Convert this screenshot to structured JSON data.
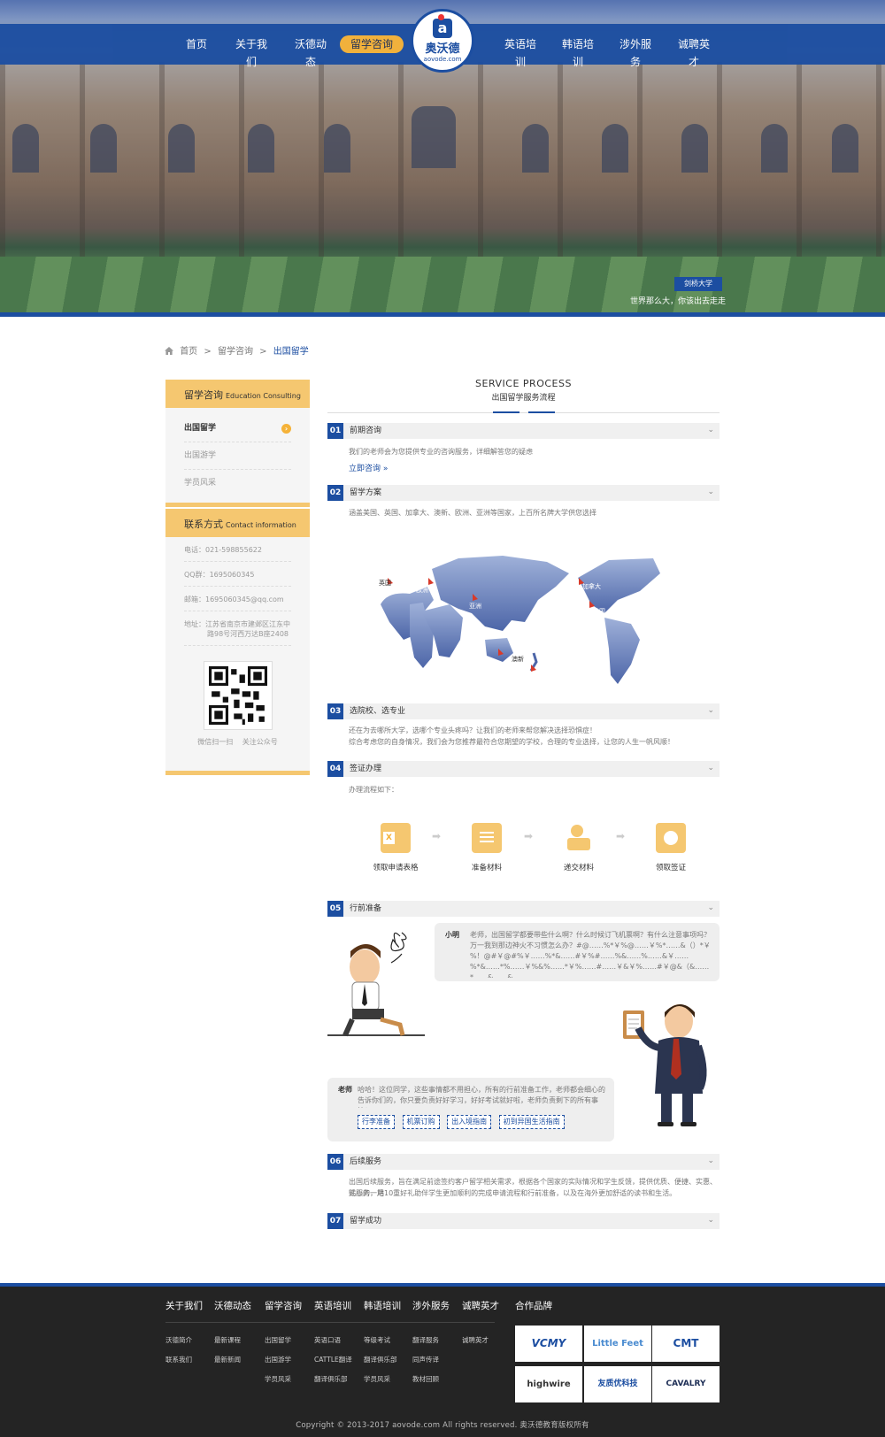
{
  "nav": {
    "left": [
      "首页",
      "关于我们",
      "沃德动态",
      "留学咨询"
    ],
    "right": [
      "英语培训",
      "韩语培训",
      "涉外服务",
      "诚聘英才"
    ],
    "active": "留学咨询"
  },
  "logo": {
    "name": "奥沃德",
    "domain": "aovode.com",
    "mark": "a"
  },
  "hero": {
    "badge": "剑桥大学",
    "slogan": "世界那么大，你该出去走走"
  },
  "breadcrumb": {
    "home": "首页",
    "sep": ">",
    "level1": "留学咨询",
    "current": "出国留学"
  },
  "sidebar": {
    "consult": {
      "title": "留学咨询",
      "subtitle": "Education Consulting",
      "items": [
        "出国留学",
        "出国游学",
        "学员风采"
      ],
      "arrow": "›"
    },
    "contact": {
      "title": "联系方式",
      "subtitle": "Contact information",
      "phone": "电话：021-598855622",
      "qq": "QQ群：1695060345",
      "email": "邮箱：1695060345@qq.com",
      "address": "地址：江苏省南京市建邺区江东中",
      "address2": "路98号河西万达B座2408",
      "qr_caption": "微信扫一扫 关注公众号"
    }
  },
  "main": {
    "title_en": "SERVICE PROCESS",
    "title_cn": "出国留学服务流程",
    "steps": [
      {
        "num": "01",
        "label": "前期咨询",
        "text": "我们的老师会为您提供专业的咨询服务，详细解答您的疑虑",
        "link": "立即咨询 »"
      },
      {
        "num": "02",
        "label": "留学方案",
        "text": "涵盖美国、英国、加拿大、澳新、欧洲、亚洲等国家，上百所名牌大学供您选择"
      },
      {
        "num": "03",
        "label": "选院校、选专业",
        "text": "还在为去哪所大学，选哪个专业头疼吗？让我们的老师来帮您解决选择恐惧症！",
        "text2": "综合考虑您的自身情况，我们会为您推荐最符合您期望的学校，合理的专业选择，让您的人生一帆风顺！"
      },
      {
        "num": "04",
        "label": "签证办理",
        "text": "办理流程如下："
      },
      {
        "num": "05",
        "label": "行前准备"
      },
      {
        "num": "06",
        "label": "后续服务",
        "text": "出国后续服务，旨在满足前途签约客户留学相关需求，根据各个国家的实际情况和学生反馈，提供优质、便捷、实惠、贴心的一站",
        "text2": "式服务，用10重好礼助伴学生更加顺利的完成申请流程和行前准备，以及在海外更加舒适的读书和生活。"
      },
      {
        "num": "07",
        "label": "留学成功"
      }
    ],
    "chevron": "⌄",
    "map_labels": [
      "英国",
      "欧洲",
      "亚洲",
      "加拿大",
      "美国",
      "澳新"
    ],
    "visa": [
      "领取申请表格",
      "准备材料",
      "递交材料",
      "领取签证"
    ],
    "chat": {
      "student_name": "小明",
      "student_text": "老师，出国留学都要带些什么啊？什么时候订飞机票啊？有什么注意事项吗？万一我到那边神火不习惯怎么办？#@……%*￥%@……￥%*……&（）*￥%！@#￥@#%￥……%*&……#￥%#……%&……%……&￥……%*&……*%……￥%&%……*￥%……#……￥&￥%……#￥@&（&……*……&……&",
      "teacher_name": "老师",
      "teacher_text": "哈哈！这位同学，这些事情都不用担心，所有的行前准备工作，老师都会细心的告诉你们的，你只要负责好好学习，好好考试就好啦，老师负责剩下的所有事情！",
      "tags": [
        "行李准备",
        "机票订购",
        "出入境指南",
        "初到异国生活指南"
      ]
    }
  },
  "footer": {
    "columns": [
      {
        "title": "关于我们",
        "links": [
          "沃德简介",
          "联系我们"
        ]
      },
      {
        "title": "沃德动态",
        "links": [
          "最新课程",
          "最新新闻"
        ]
      },
      {
        "title": "留学咨询",
        "links": [
          "出国留学",
          "出国游学",
          "学员风采"
        ]
      },
      {
        "title": "英语培训",
        "links": [
          "英语口语",
          "CATTLE翻译",
          "翻译俱乐部"
        ]
      },
      {
        "title": "韩语培训",
        "links": [
          "等级考试",
          "翻译俱乐部",
          "学员风采"
        ]
      },
      {
        "title": "涉外服务",
        "links": [
          "翻译服务",
          "同声传译",
          "教材回顾"
        ]
      },
      {
        "title": "诚聘英才",
        "links": [
          "诚聘英才"
        ]
      }
    ],
    "brands_title": "合作品牌",
    "brands": [
      "VCMY",
      "Little Feet",
      "CMT",
      "highwire",
      "友质优科技",
      "CAVALRY"
    ],
    "copyright": "Copyright © 2013-2017 aovode.com All rights reserved. 奥沃德教育版权所有"
  },
  "colors": {
    "primary": "#1c4ea1",
    "accent": "#f5c770",
    "footer": "#242424"
  }
}
